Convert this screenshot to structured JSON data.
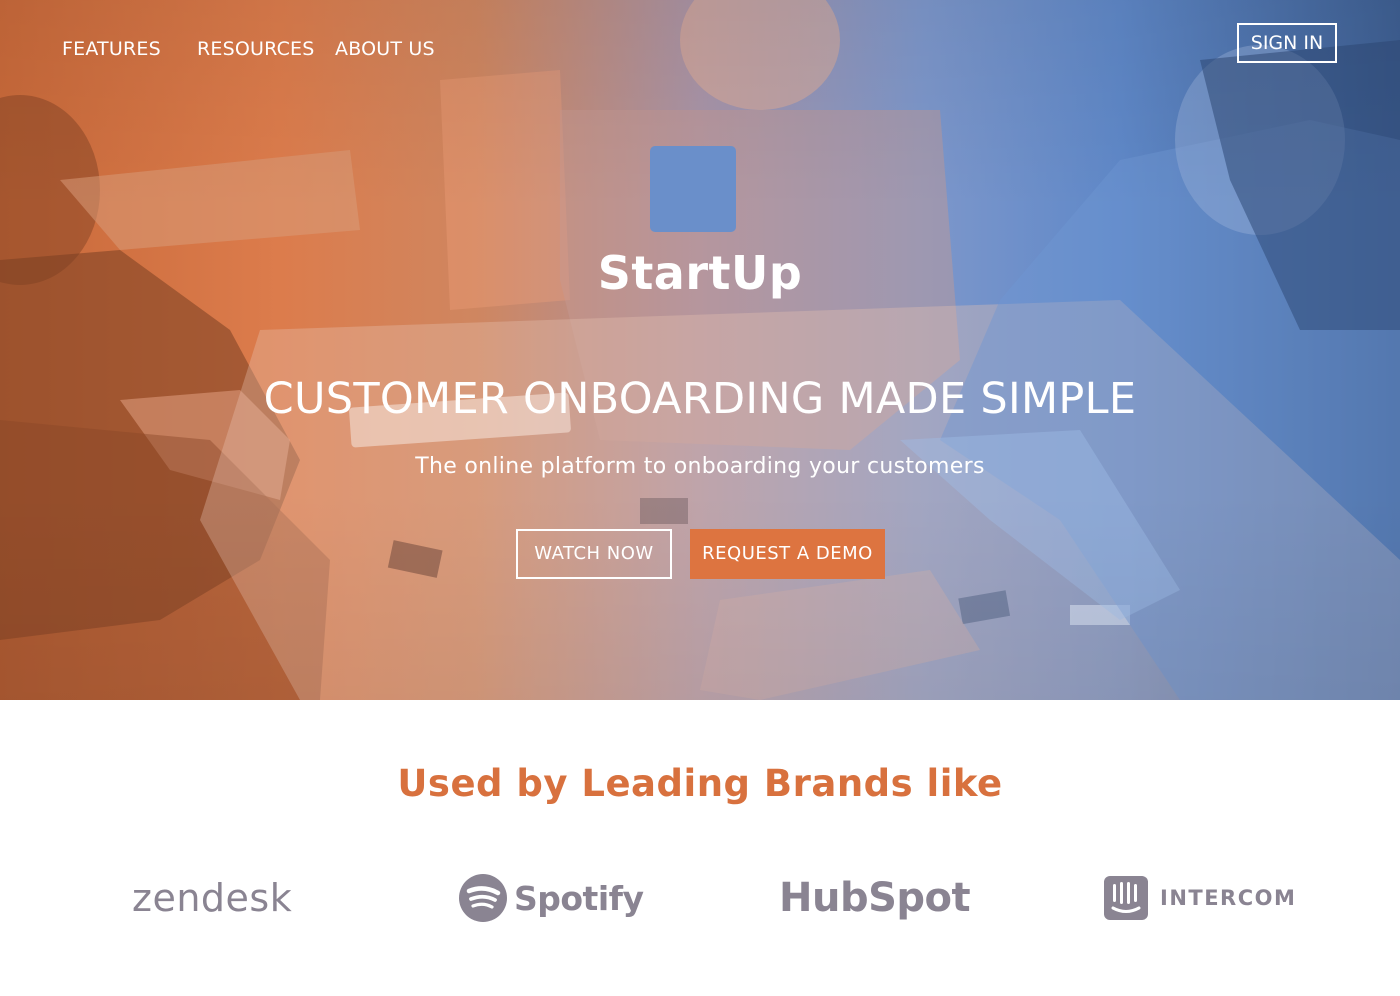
{
  "nav": {
    "items": [
      {
        "label": "FEATURES"
      },
      {
        "label": "RESOURCES"
      },
      {
        "label": "ABOUT US"
      }
    ],
    "signin_label": "SIGN IN"
  },
  "hero": {
    "brand_name": "StartUp",
    "headline": "CUSTOMER ONBOARDING MADE SIMPLE",
    "subheadline": "The online platform to onboarding your customers",
    "watch_label": "WATCH NOW",
    "demo_label": "REQUEST A DEMO",
    "logo_icon": "square-logo-icon"
  },
  "brands": {
    "title": "Used by Leading Brands like",
    "logos": [
      {
        "name": "zendesk",
        "icon": "zendesk-logo"
      },
      {
        "name": "Spotify",
        "icon": "spotify-logo"
      },
      {
        "name": "HubSpot",
        "icon": "hubspot-logo"
      },
      {
        "name": "INTERCOM",
        "icon": "intercom-logo"
      }
    ]
  },
  "colors": {
    "accent_orange": "#dd7440",
    "logo_blue": "#6a8fca",
    "brand_gray": "#8a8492",
    "title_orange": "#d8713e"
  }
}
